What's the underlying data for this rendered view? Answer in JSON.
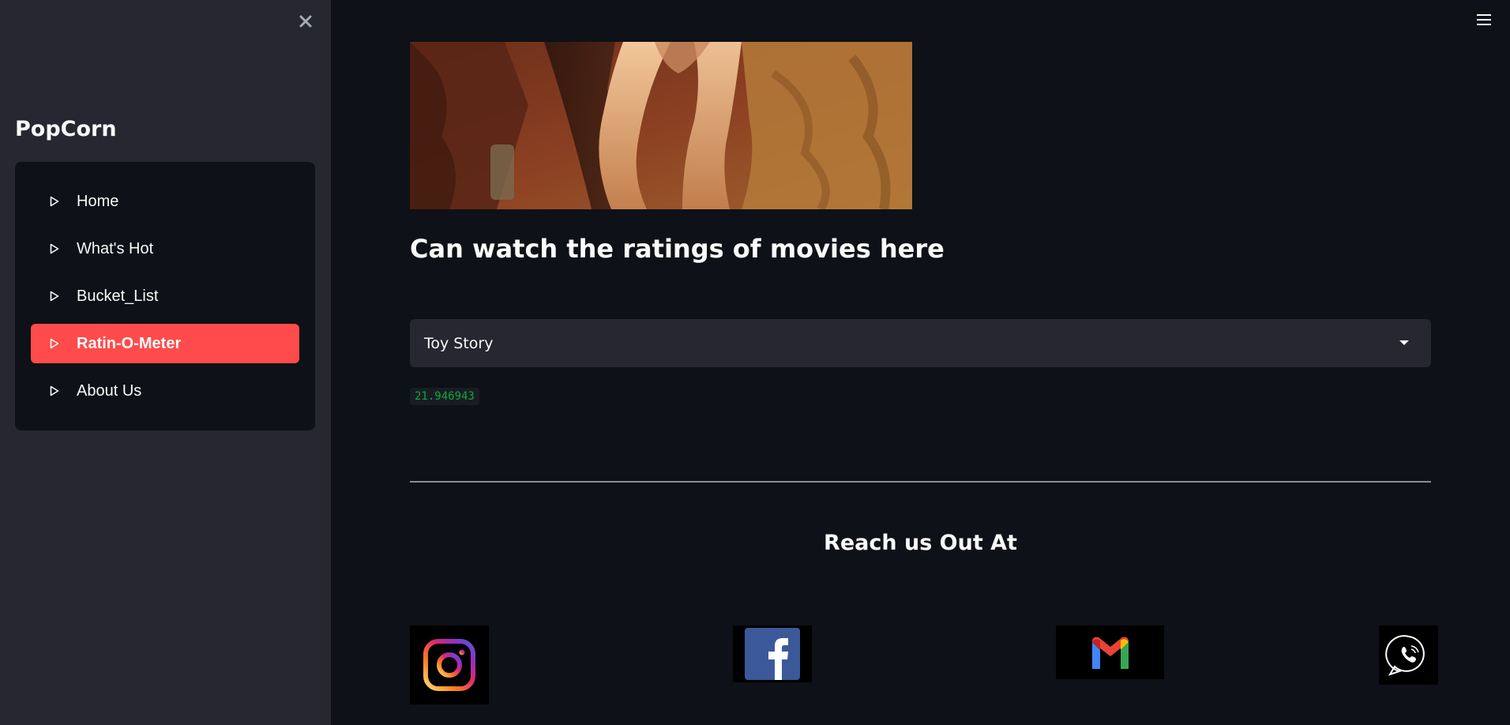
{
  "sidebar": {
    "title": "PopCorn",
    "items": [
      {
        "label": "Home"
      },
      {
        "label": "What's Hot"
      },
      {
        "label": "Bucket_List"
      },
      {
        "label": "Ratin-O-Meter",
        "active": true
      },
      {
        "label": "About Us"
      }
    ]
  },
  "main": {
    "heading": "Can watch the ratings of movies here",
    "select": {
      "value": "Toy Story"
    },
    "rating": "21.946943",
    "reach_heading": "Reach us Out At"
  },
  "social_icons": [
    "instagram-icon",
    "facebook-icon",
    "gmail-icon",
    "phone-icon"
  ],
  "colors": {
    "accent": "#ff4b4b",
    "background": "#0e1117",
    "sidebar": "#262730",
    "rating_text": "#09ab3b"
  }
}
